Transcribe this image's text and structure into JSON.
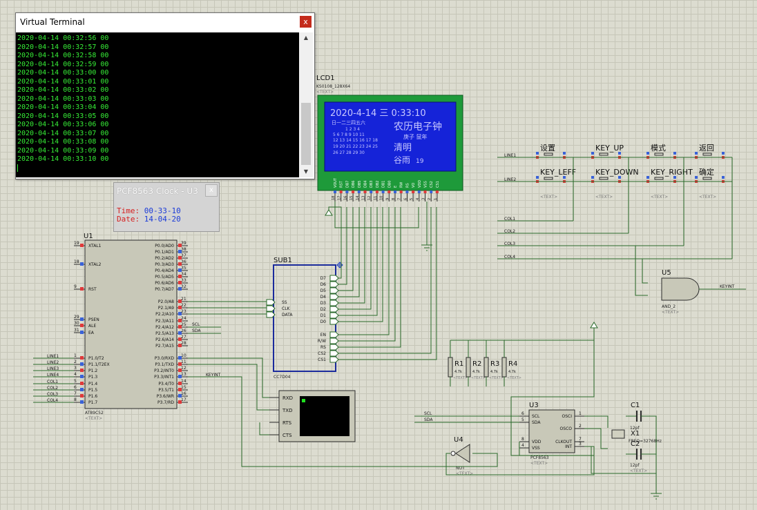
{
  "terminal": {
    "title": "Virtual Terminal",
    "close": "x",
    "lines": [
      "2020-04-14 00:32:56 00",
      "2020-04-14 00:32:57 00",
      "2020-04-14 00:32:58 00",
      "2020-04-14 00:32:59 00",
      "2020-04-14 00:33:00 00",
      "2020-04-14 00:33:01 00",
      "2020-04-14 00:33:02 00",
      "2020-04-14 00:33:03 00",
      "2020-04-14 00:33:04 00",
      "2020-04-14 00:33:05 00",
      "2020-04-14 00:33:06 00",
      "2020-04-14 00:33:07 00",
      "2020-04-14 00:33:08 00",
      "2020-04-14 00:33:09 00",
      "2020-04-14 00:33:10 00"
    ]
  },
  "clock": {
    "title": "PCF8563 Clock - U3",
    "close": "x",
    "time_label": "Time:",
    "time_value": "00-33-10",
    "date_label": "Date:",
    "date_value": "14-04-20"
  },
  "lcd": {
    "ref": "LCD1",
    "part": "KS0108_128X64",
    "text_tag": "<TEXT>",
    "datetime": "2020-4-14 三 0:33:10",
    "calendar": [
      "日一二三四五六",
      "1 2 3 4",
      "5 6 7 8 9 10 11",
      "12 13 14 15 16 17 18",
      "19 20 21 22 23 24 25",
      "26 27 28 29 30"
    ],
    "title": "农历电子钟",
    "lunar": "庚子 鼠年",
    "festival": "清明",
    "day_label": "谷雨",
    "day_num": "19",
    "pins": [
      "VOUT",
      "RST",
      "DB7",
      "DB6",
      "DB5",
      "DB4",
      "DB3",
      "DB2",
      "DB1",
      "DB0",
      "E",
      "RW",
      "RS",
      "VO",
      "VDD",
      "VSS",
      "CS2",
      "CS1"
    ],
    "pin_nums": [
      "18",
      "17",
      "16",
      "15",
      "14",
      "13",
      "12",
      "11",
      "10",
      "9",
      "8",
      "7",
      "6",
      "5",
      "4",
      "3",
      "2",
      "1"
    ]
  },
  "u1": {
    "ref": "U1",
    "part": "AT89C52",
    "text_tag": "<TEXT>",
    "left_pins": [
      {
        "num": "19",
        "name": "XTAL1"
      },
      {
        "num": "18",
        "name": "XTAL2"
      },
      {
        "num": "9",
        "name": "RST"
      },
      {
        "num": "29",
        "name": "PSEN"
      },
      {
        "num": "30",
        "name": "ALE"
      },
      {
        "num": "31",
        "name": "EA"
      },
      {
        "num": "1",
        "name": "P1.0/T2"
      },
      {
        "num": "2",
        "name": "P1.1/T2EX"
      },
      {
        "num": "3",
        "name": "P1.2"
      },
      {
        "num": "4",
        "name": "P1.3"
      },
      {
        "num": "5",
        "name": "P1.4"
      },
      {
        "num": "6",
        "name": "P1.5"
      },
      {
        "num": "7",
        "name": "P1.6"
      },
      {
        "num": "8",
        "name": "P1.7"
      }
    ],
    "right_pins": [
      {
        "num": "39",
        "name": "P0.0/AD0"
      },
      {
        "num": "38",
        "name": "P0.1/AD1"
      },
      {
        "num": "37",
        "name": "P0.2/AD2"
      },
      {
        "num": "36",
        "name": "P0.3/AD3"
      },
      {
        "num": "35",
        "name": "P0.4/AD4"
      },
      {
        "num": "34",
        "name": "P0.5/AD5"
      },
      {
        "num": "33",
        "name": "P0.6/AD6"
      },
      {
        "num": "32",
        "name": "P0.7/AD7"
      },
      {
        "num": "21",
        "name": "P2.0/A8"
      },
      {
        "num": "22",
        "name": "P2.1/A9"
      },
      {
        "num": "23",
        "name": "P2.2/A10"
      },
      {
        "num": "24",
        "name": "P2.3/A11"
      },
      {
        "num": "25",
        "name": "P2.4/A12"
      },
      {
        "num": "26",
        "name": "P2.5/A13"
      },
      {
        "num": "27",
        "name": "P2.6/A14"
      },
      {
        "num": "28",
        "name": "P2.7/A15"
      },
      {
        "num": "10",
        "name": "P3.0/RXD"
      },
      {
        "num": "11",
        "name": "P3.1/TXD"
      },
      {
        "num": "12",
        "name": "P3.2/INT0"
      },
      {
        "num": "13",
        "name": "P3.3/INT1"
      },
      {
        "num": "14",
        "name": "P3.4/T0"
      },
      {
        "num": "15",
        "name": "P3.5/T1"
      },
      {
        "num": "16",
        "name": "P3.6/WR"
      },
      {
        "num": "17",
        "name": "P3.7/RD"
      }
    ],
    "line_labels": [
      "LINE1",
      "LINE2",
      "LINE3",
      "LINE4",
      "COL1",
      "COL2",
      "COL3",
      "COL4"
    ],
    "net_scl": "SCL",
    "net_sda": "SDA",
    "net_keyint": "KEYINT"
  },
  "sub1": {
    "ref": "SUB1",
    "part": "CC7D04",
    "left": [
      "SS",
      "CLK",
      "DATA"
    ],
    "right": [
      "D7",
      "D6",
      "D5",
      "D4",
      "D3",
      "D2",
      "D1",
      "D0",
      "EN",
      "R/W",
      "RS",
      "CS2",
      "CS1"
    ]
  },
  "keys": {
    "row1": [
      "设置",
      "KEY_UP",
      "模式",
      "返回"
    ],
    "row2": [
      "KEY_LEFF",
      "KEY_DOWN",
      "KEY_RIGHT",
      "确定"
    ],
    "lines": [
      "LINE1",
      "LINE2"
    ],
    "cols": [
      "COL1",
      "COL2",
      "COL3",
      "COL4"
    ],
    "text_tag": "<TEXT>"
  },
  "u5": {
    "ref": "U5",
    "part": "AND_2",
    "text_tag": "<TEXT>",
    "out": "KEYINT"
  },
  "resistors": {
    "refs": [
      "R1",
      "R2",
      "R3",
      "R4"
    ],
    "value": "4.7k",
    "text_tag": "<TEXT>"
  },
  "u3": {
    "ref": "U3",
    "part": "PCF8563",
    "text_tag": "<TEXT>",
    "left": [
      "SCL",
      "SDA",
      "VDD",
      "VSS"
    ],
    "right": [
      "OSCI",
      "OSCO",
      "CLKOUT",
      "INT"
    ],
    "left_nums": [
      "6",
      "5",
      "8",
      "4"
    ],
    "right_nums": [
      "1",
      "2",
      "7",
      "3"
    ],
    "net_scl": "SCL",
    "net_sda": "SDA"
  },
  "u4": {
    "ref": "U4",
    "part": "NOT",
    "text_tag": "<TEXT>"
  },
  "c1": {
    "ref": "C1",
    "value": "12pf",
    "text_tag": "<TEXT>"
  },
  "c2": {
    "ref": "C2",
    "value": "12pf",
    "text_tag": "<TEXT>"
  },
  "x1": {
    "ref": "X1",
    "value": "FREQ=32768Hz"
  },
  "vterm": {
    "pins": [
      "RXD",
      "TXD",
      "RTS",
      "CTS"
    ]
  }
}
